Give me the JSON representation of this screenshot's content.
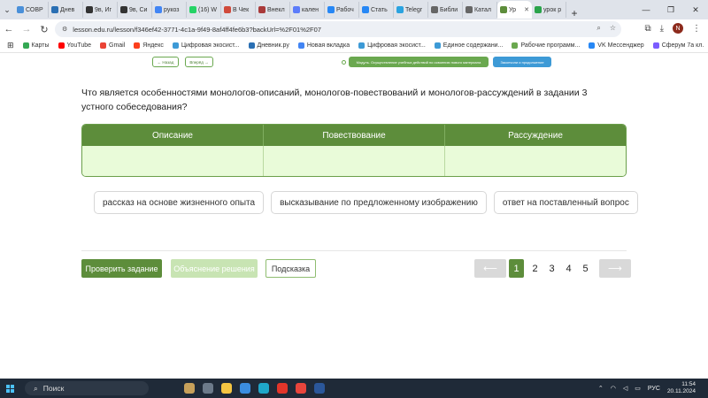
{
  "browser": {
    "tabs": [
      {
        "label": "СОВР",
        "color": "#4a90d9"
      },
      {
        "label": "Днев",
        "color": "#2a6fb3"
      },
      {
        "label": "9в, Иг",
        "color": "#333333"
      },
      {
        "label": "9в, Си",
        "color": "#333333"
      },
      {
        "label": "рукоз",
        "color": "#4285f4"
      },
      {
        "label": "(16) W",
        "color": "#25d366"
      },
      {
        "label": "В Чек",
        "color": "#d04a3b"
      },
      {
        "label": "Внекл",
        "color": "#a93a3a"
      },
      {
        "label": "кален",
        "color": "#5c7cfa"
      },
      {
        "label": "Рабоч",
        "color": "#2787f5"
      },
      {
        "label": "Стать",
        "color": "#2787f5"
      },
      {
        "label": "Telegr",
        "color": "#2aa3e0"
      },
      {
        "label": "Библи",
        "color": "#666666"
      },
      {
        "label": "Катал",
        "color": "#666666"
      },
      {
        "label": "Ур",
        "color": "#5d8d3b",
        "active": true
      },
      {
        "label": "урок р",
        "color": "#2aa34a"
      }
    ],
    "url": "lesson.edu.ru/lesson/f346ef42-3771-4c1a-9f49-8af4ff4fe6b3?backUrl=%2F01%2F07",
    "avatar_letter": "N",
    "bookmarks": [
      {
        "label": "Карты",
        "color": "#34a853"
      },
      {
        "label": "YouTube",
        "color": "#ff0000"
      },
      {
        "label": "Gmail",
        "color": "#ea4335"
      },
      {
        "label": "Яндекс",
        "color": "#fc3f1d"
      },
      {
        "label": "Цифровая экосист...",
        "color": "#3d9ad6"
      },
      {
        "label": "Дневник.ру",
        "color": "#2a6fb3"
      },
      {
        "label": "Новая вкладка",
        "color": "#4285f4"
      },
      {
        "label": "Цифровая экосист...",
        "color": "#3d9ad6"
      },
      {
        "label": "Единое содержани...",
        "color": "#3d9ad6"
      },
      {
        "label": "Рабочие программ...",
        "color": "#6aa84f"
      },
      {
        "label": "VK Мессенджер",
        "color": "#2787f5"
      },
      {
        "label": "Сферум 7а кл.",
        "color": "#7b5cff"
      }
    ]
  },
  "page": {
    "back_label": "← Назад",
    "forward_label": "Вперёд →",
    "module_label": "Модуль. Осуществление учебных действий по освоению нового материала",
    "mode_label": "Закончили и продолжение",
    "question": "Что является особенностями монологов-описаний, монологов-повествований и монологов-рассуждений в задании 3 устного собеседования?",
    "columns": [
      "Описание",
      "Повествование",
      "Рассуждение"
    ],
    "options": [
      "рассказ на основе жизненного опыта",
      "высказывание по предложенному изображению",
      "ответ на поставленный вопрос"
    ],
    "check_label": "Проверить задание",
    "explain_label": "Объяснение решения",
    "hint_label": "Подсказка",
    "pages": [
      "1",
      "2",
      "3",
      "4",
      "5"
    ],
    "current_page": "1",
    "prev_arrow": "⟵",
    "next_arrow": "⟶"
  },
  "taskbar": {
    "search_label": "Поиск",
    "lang": "РУС",
    "time": "11:54",
    "date": "20.11.2024"
  }
}
